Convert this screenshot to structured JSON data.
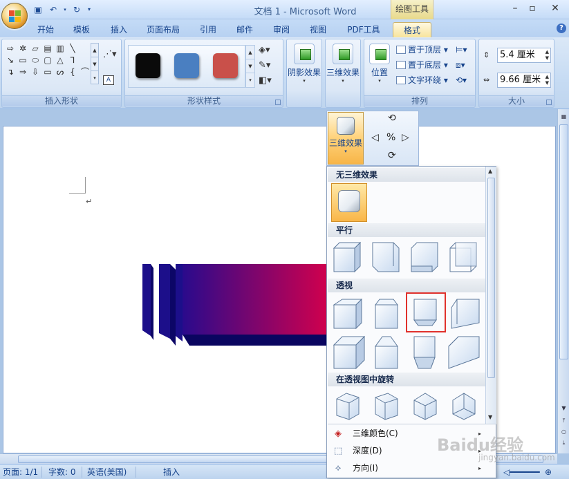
{
  "window": {
    "title": "文档 1 - Microsoft Word",
    "context_tools_label": "绘图工具"
  },
  "tabs": [
    "开始",
    "模板",
    "插入",
    "页面布局",
    "引用",
    "邮件",
    "审阅",
    "视图",
    "PDF工具",
    "格式"
  ],
  "active_tab": "格式",
  "ribbon": {
    "insert_shapes_label": "插入形状",
    "shape_styles_label": "形状样式",
    "shape_style_colors": [
      "#0a0a0a",
      "#4a7fc1",
      "#c9504a"
    ],
    "shadow_effects_label": "阴影效果",
    "effects_3d_label": "三维效果",
    "arrange_label": "排列",
    "position_label": "位置",
    "bring_front_label": "置于顶层",
    "send_back_label": "置于底层",
    "text_wrap_label": "文字环绕",
    "size_label": "大小",
    "height_value": "5.4 厘米",
    "width_value": "9.66 厘米"
  },
  "float_3d": {
    "button_label": "三维效果"
  },
  "gallery": {
    "none_header": "无三维效果",
    "parallel_header": "平行",
    "perspective_header": "透视",
    "rotate_header": "在透视图中旋转",
    "menu": [
      {
        "label": "三维颜色(C)",
        "icon": "paint-bucket-icon"
      },
      {
        "label": "深度(D)",
        "icon": "depth-icon"
      },
      {
        "label": "方向(I)",
        "icon": "direction-icon"
      }
    ]
  },
  "status": {
    "page": "页面: 1/1",
    "words": "字数: 0",
    "language": "英语(美国)",
    "mode": "插入"
  },
  "watermark": {
    "text": "Baidu经验",
    "sub": "jingyan.baidu.com"
  },
  "colors": {
    "gradient_start": "#2a0a8c",
    "gradient_end": "#d4004c",
    "highlight": "#e0312c"
  }
}
